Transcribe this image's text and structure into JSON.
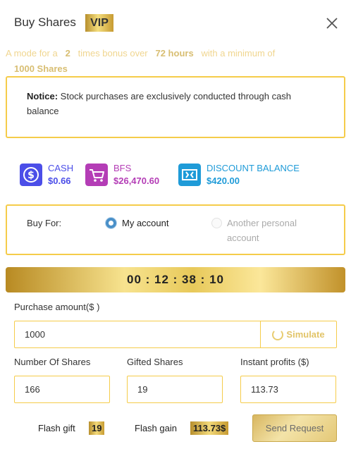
{
  "header": {
    "title": "Buy Shares",
    "badge": "VIP"
  },
  "mode": {
    "text_a": "A mode for a",
    "multiplier": "2",
    "text_b": "times bonus over",
    "duration": "72 hours",
    "text_c": "with a minimum of",
    "minimum": "1000 Shares"
  },
  "notice": {
    "label": "Notice:",
    "text": " Stock purchases are exclusively conducted through cash balance"
  },
  "balances": [
    {
      "label": "CASH",
      "value": "$0.66",
      "color": "#4b4ee8",
      "icon": "dollar-icon"
    },
    {
      "label": "BFS",
      "value": "$26,470.60",
      "color": "#b43db6",
      "icon": "cart-icon"
    },
    {
      "label": "DISCOUNT BALANCE",
      "value": "$420.00",
      "color": "#1f9bd8",
      "icon": "discount-icon"
    }
  ],
  "buy_for": {
    "label": "Buy For:",
    "options": [
      {
        "label": "My account",
        "selected": true
      },
      {
        "label_line1": "Another personal",
        "label_line2": "account",
        "selected": false
      }
    ]
  },
  "timer": "00 : 12 : 38 : 10",
  "purchase": {
    "label": "Purchase amount($ )",
    "value": "1000",
    "simulate_label": "Simulate"
  },
  "fields": {
    "shares_label": "Number Of Shares",
    "shares_value": "166",
    "gifted_label": "Gifted Shares",
    "gifted_value": "19",
    "profits_label": "Instant profits ($)",
    "profits_value": "113.73"
  },
  "flash": {
    "gift_label": "Flash gift",
    "gift_value": "19",
    "gain_label": "Flash gain",
    "gain_value": "113.73$"
  },
  "send_label": "Send Request"
}
